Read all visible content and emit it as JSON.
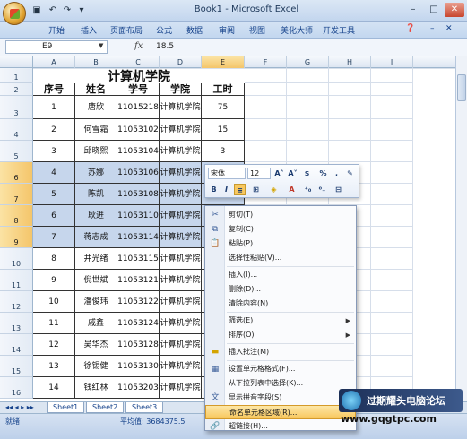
{
  "window": {
    "title": "Book1 - Microsoft Excel"
  },
  "ribbon_tabs": [
    "开始",
    "插入",
    "页面布局",
    "公式",
    "数据",
    "审阅",
    "视图",
    "美化大师",
    "开发工具"
  ],
  "formula_bar": {
    "name_box": "E9",
    "fx": "fx",
    "value": "18.5"
  },
  "columns": [
    "A",
    "B",
    "C",
    "D",
    "E",
    "F",
    "G",
    "H",
    "I"
  ],
  "rows": [
    "1",
    "2",
    "3",
    "4",
    "5",
    "6",
    "7",
    "8",
    "9",
    "10",
    "11",
    "12",
    "13",
    "14",
    "15",
    "16"
  ],
  "sheet": {
    "title": "计算机学院",
    "headers": [
      "序号",
      "姓名",
      "学号",
      "学院",
      "工时"
    ],
    "records": [
      {
        "no": "1",
        "name": "唐欣",
        "id": "11015218",
        "college": "计算机学院",
        "hours": "75"
      },
      {
        "no": "2",
        "name": "何雪霜",
        "id": "11053102",
        "college": "计算机学院",
        "hours": "15"
      },
      {
        "no": "3",
        "name": "邱晓熙",
        "id": "11053104",
        "college": "计算机学院",
        "hours": "3"
      },
      {
        "no": "4",
        "name": "苏娜",
        "id": "11053106",
        "college": "计算机学院",
        "hours": ""
      },
      {
        "no": "5",
        "name": "陈凯",
        "id": "11053108",
        "college": "计算机学院",
        "hours": ""
      },
      {
        "no": "6",
        "name": "耿进",
        "id": "11053110",
        "college": "计算机学院",
        "hours": ""
      },
      {
        "no": "7",
        "name": "蒋志成",
        "id": "11053114",
        "college": "计算机学院",
        "hours": ""
      },
      {
        "no": "8",
        "name": "井光绪",
        "id": "11053115",
        "college": "计算机学院",
        "hours": ""
      },
      {
        "no": "9",
        "name": "倪世斌",
        "id": "11053121",
        "college": "计算机学院",
        "hours": ""
      },
      {
        "no": "10",
        "name": "潘俊玮",
        "id": "11053122",
        "college": "计算机学院",
        "hours": ""
      },
      {
        "no": "11",
        "name": "戚鑫",
        "id": "11053124",
        "college": "计算机学院",
        "hours": ""
      },
      {
        "no": "12",
        "name": "吴华杰",
        "id": "11053128",
        "college": "计算机学院",
        "hours": ""
      },
      {
        "no": "13",
        "name": "徐锡健",
        "id": "11053130",
        "college": "计算机学院",
        "hours": ""
      },
      {
        "no": "14",
        "name": "钱红林",
        "id": "11053203",
        "college": "计算机学院",
        "hours": ""
      }
    ]
  },
  "mini_toolbar": {
    "font": "宋体",
    "size": "12",
    "bold": "B",
    "italic": "I",
    "percent": "%"
  },
  "context_menu": {
    "items": [
      "剪切(T)",
      "复制(C)",
      "粘贴(P)",
      "选择性粘贴(V)...",
      "插入(I)...",
      "删除(D)...",
      "清除内容(N)",
      "筛选(E)",
      "排序(O)",
      "插入批注(M)",
      "设置单元格格式(F)...",
      "从下拉列表中选择(K)...",
      "显示拼音字段(S)",
      "命名单元格区域(R)...",
      "超链接(H)..."
    ],
    "highlighted": "命名单元格区域(R)..."
  },
  "sheet_tabs": [
    "Sheet1",
    "Sheet2",
    "Sheet3"
  ],
  "status": {
    "ready": "就绪",
    "average": "平均值: 3684375.5"
  },
  "watermark": {
    "brand": "过期耀头电脑论坛",
    "url": "www.gqgtpc.com"
  }
}
